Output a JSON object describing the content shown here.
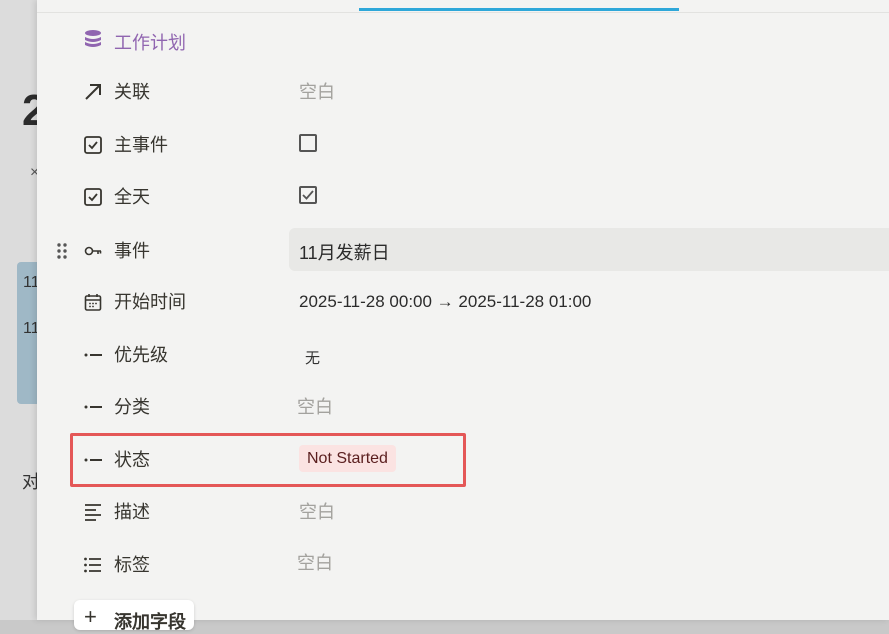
{
  "background": {
    "big_char": "2",
    "x_char": "×",
    "card_lines": [
      "11",
      "11"
    ],
    "side_char": "对"
  },
  "panel": {
    "database_title": "工作计划",
    "properties": [
      {
        "label": "关联",
        "icon": "arrow-up-right-icon",
        "value": "空白"
      },
      {
        "label": "主事件",
        "icon": "checkbox-icon",
        "checked": false
      },
      {
        "label": "全天",
        "icon": "checkbox-icon",
        "checked": true
      },
      {
        "label": "事件",
        "icon": "key-icon",
        "value": "11月发薪日"
      },
      {
        "label": "开始时间",
        "icon": "calendar-icon",
        "value": "2025-11-28 00:00 → 2025-11-28 01:00"
      },
      {
        "label": "优先级",
        "icon": "select-icon",
        "value": "无"
      },
      {
        "label": "分类",
        "icon": "select-icon",
        "value": "空白"
      },
      {
        "label": "状态",
        "icon": "select-icon",
        "value": "Not Started"
      },
      {
        "label": "描述",
        "icon": "text-lines-icon",
        "value": "空白"
      },
      {
        "label": "标签",
        "icon": "list-icon",
        "value": "空白"
      }
    ],
    "add_field_label": "添加字段",
    "status_tag_color": "#fbe3e2",
    "accent_color": "#2ea7d9",
    "highlight_color": "#e45757"
  }
}
